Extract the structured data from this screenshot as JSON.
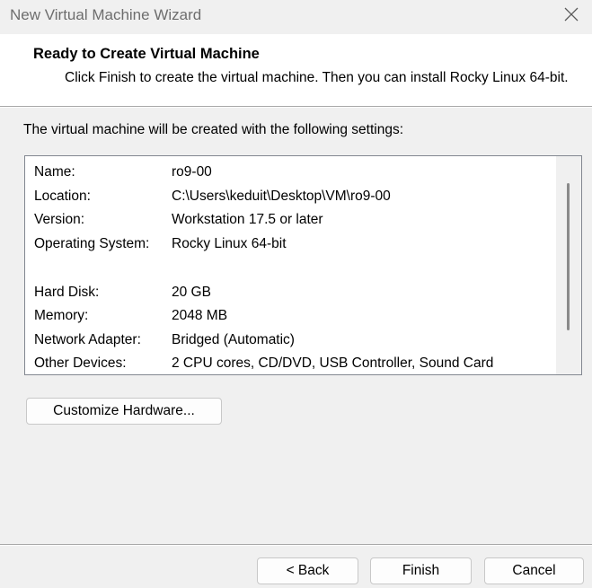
{
  "window": {
    "title": "New Virtual Machine Wizard",
    "close_icon": "close-icon"
  },
  "header": {
    "title": "Ready to Create Virtual Machine",
    "description": "Click Finish to create the virtual machine. Then you can install Rocky Linux 64-bit."
  },
  "intro_text": "The virtual machine will be created with the following settings:",
  "settings": {
    "name": {
      "label": "Name:",
      "value": "ro9-00"
    },
    "location": {
      "label": "Location:",
      "value": "C:\\Users\\keduit\\Desktop\\VM\\ro9-00"
    },
    "version": {
      "label": "Version:",
      "value": "Workstation 17.5 or later"
    },
    "os": {
      "label": "Operating System:",
      "value": "Rocky Linux 64-bit"
    },
    "hard_disk": {
      "label": "Hard Disk:",
      "value": "20 GB"
    },
    "memory": {
      "label": "Memory:",
      "value": "2048 MB"
    },
    "network": {
      "label": "Network Adapter:",
      "value": "Bridged (Automatic)"
    },
    "other": {
      "label": "Other Devices:",
      "value": "2 CPU cores, CD/DVD, USB Controller, Sound Card"
    }
  },
  "buttons": {
    "customize": "Customize Hardware...",
    "back": "< Back",
    "finish": "Finish",
    "cancel": "Cancel"
  },
  "colors": {
    "header_bg": "#ffffff",
    "window_bg": "#f0f0f0",
    "title_text": "#6e6e6e"
  }
}
